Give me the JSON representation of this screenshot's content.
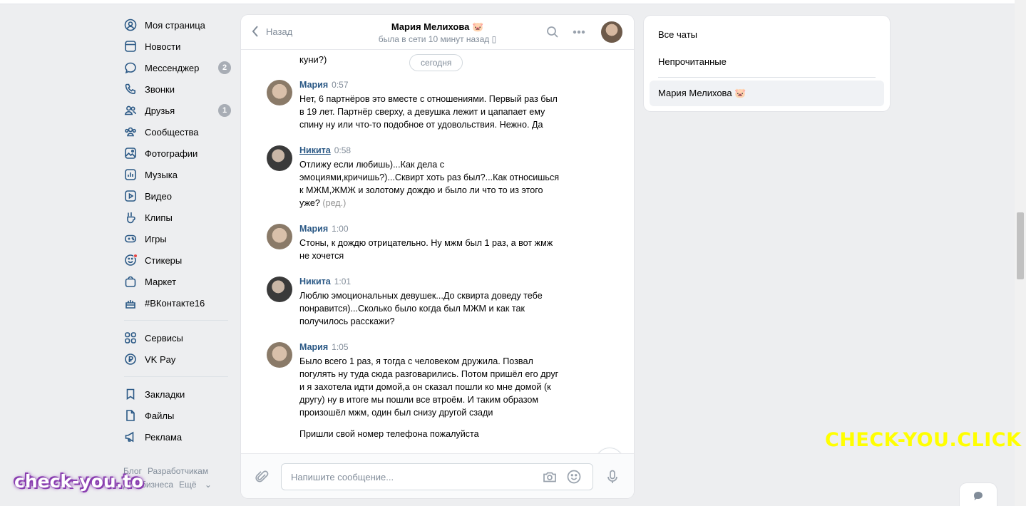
{
  "nav": {
    "items": [
      {
        "label": "Моя страница",
        "icon": "user-circle-icon"
      },
      {
        "label": "Новости",
        "icon": "news-icon"
      },
      {
        "label": "Мессенджер",
        "icon": "messenger-icon",
        "count": "2"
      },
      {
        "label": "Звонки",
        "icon": "phone-icon"
      },
      {
        "label": "Друзья",
        "icon": "friends-icon",
        "count": "1"
      },
      {
        "label": "Сообщества",
        "icon": "communities-icon"
      },
      {
        "label": "Фотографии",
        "icon": "photos-icon"
      },
      {
        "label": "Музыка",
        "icon": "music-icon"
      },
      {
        "label": "Видео",
        "icon": "video-icon"
      },
      {
        "label": "Клипы",
        "icon": "clips-icon"
      },
      {
        "label": "Игры",
        "icon": "games-icon"
      },
      {
        "label": "Стикеры",
        "icon": "stickers-icon"
      },
      {
        "label": "Маркет",
        "icon": "market-icon"
      },
      {
        "label": "#ВКонтакте16",
        "icon": "cake-icon"
      }
    ],
    "items2": [
      {
        "label": "Сервисы",
        "icon": "services-icon"
      },
      {
        "label": "VK Pay",
        "icon": "vkpay-icon"
      }
    ],
    "items3": [
      {
        "label": "Закладки",
        "icon": "bookmark-icon"
      },
      {
        "label": "Файлы",
        "icon": "file-icon"
      },
      {
        "label": "Реклама",
        "icon": "megaphone-icon"
      }
    ],
    "footer": {
      "blog": "Блог",
      "developers": "Разработчикам",
      "business": "Для бизнеса",
      "more": "Ещё"
    }
  },
  "chat": {
    "back_label": "Назад",
    "contact_name": "Мария Мелихова",
    "contact_emoji": "🐷",
    "status": "была в сети 10 минут назад",
    "prev_text": "куни?)",
    "date_label": "сегодня",
    "messages": [
      {
        "author": "Мария",
        "time": "0:57",
        "lines": [
          "Нет, 6 партнёров это вместе с отношениями. Первый раз был",
          "в 19 лет. Партнёр сверху, а девушка лежит и цапапает ему",
          "спину ну или что-то подобное от удовольствия. Нежно. Да"
        ]
      },
      {
        "author": "Никита",
        "time": "0:58",
        "lines": [
          "Отлижу если любишь)...Как дела с",
          "эмоциями,кричишь?)...Сквирт хоть раз был?...Как относишься",
          "к МЖМ,ЖМЖ и золотому дождю и было ли что то из этого",
          "уже?"
        ],
        "edited": "(ред.)"
      },
      {
        "author": "Мария",
        "time": "1:00",
        "lines": [
          "Стоны, к дождю отрицательно. Ну мжм был 1 раз, а вот жмж",
          "не хочется"
        ]
      },
      {
        "author": "Никита",
        "time": "1:01",
        "lines": [
          "Люблю эмоциональных девушек...До сквирта доведу тебе",
          "понравится)...Сколько было когда был МЖМ и как так",
          "получилось расскажи?"
        ]
      },
      {
        "author": "Мария",
        "time": "1:05",
        "lines": [
          "Было всего 1 раз, я тогда с человеком дружила. Позвал",
          "погулять ну туда сюда разговарились. Потом пришёл его друг",
          "и я захотела идти домой,а он сказал пошли ко мне домой (к",
          "другу) ну в итоге мы пошли все втроём. И таким образом",
          "произошёл мжм, один был снизу другой сзади"
        ],
        "extra": "Пришли свой номер телефона пожалуйста"
      }
    ],
    "composer": {
      "placeholder": "Напишите сообщение..."
    }
  },
  "right_panel": {
    "all_chats": "Все чаты",
    "unread": "Непрочитанные",
    "active_chat": "Мария Мелихова 🐷"
  },
  "watermarks": {
    "right": "CHECK-YOU.CLICK",
    "left": "check-you.to"
  },
  "colors": {
    "background": "#edeef0",
    "link": "#2a5885",
    "secondary_text": "#818c99",
    "badge": "#a8adb5",
    "watermark_yellow": "#ffff00",
    "watermark_purple": "#8a3fb0"
  }
}
